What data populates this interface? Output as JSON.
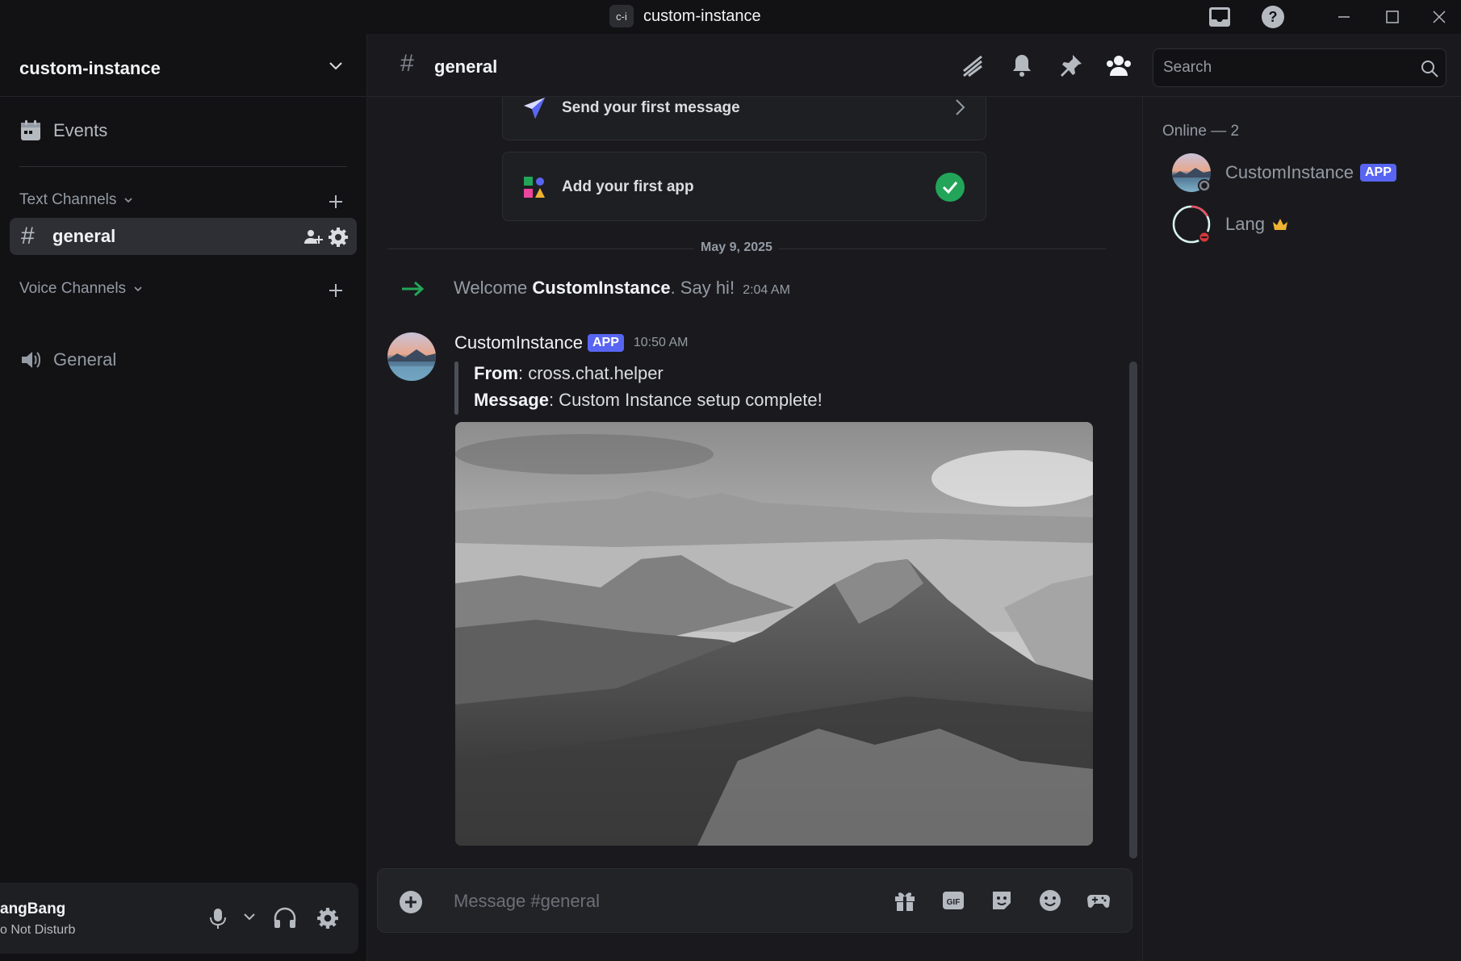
{
  "window": {
    "app_icon_text": "c-i",
    "title": "custom-instance"
  },
  "sidebar": {
    "server_name": "custom-instance",
    "events_label": "Events",
    "text_category": "Text Channels",
    "active_channel": "general",
    "voice_category": "Voice Channels",
    "voice_channel": "General"
  },
  "user": {
    "name": "angBang",
    "status": "o Not Disturb"
  },
  "channel_header": {
    "name": "general",
    "search_placeholder": "Search"
  },
  "onboarding": {
    "send_first_message": "Send your first message",
    "add_first_app": "Add your first app"
  },
  "messages": {
    "date_divider": "May 9, 2025",
    "welcome_prefix": "Welcome",
    "welcome_user": "CustomInstance",
    "welcome_suffix": ". Say hi!",
    "welcome_time": "2:04 AM",
    "author": "CustomInstance",
    "author_badge": "APP",
    "time": "10:50 AM",
    "from_label": "From",
    "from_value": ": cross.chat.helper",
    "message_label": "Message",
    "message_value": ": Custom Instance setup complete!"
  },
  "composer": {
    "placeholder": "Message #general"
  },
  "members": {
    "online_heading": "Online — 2",
    "list": [
      {
        "name": "CustomInstance",
        "badge": "APP"
      },
      {
        "name": "Lang"
      }
    ]
  },
  "colors": {
    "accent": "#5865f2",
    "online_green": "#23a559",
    "dnd_red": "#da373c",
    "crown": "#f0b232"
  }
}
